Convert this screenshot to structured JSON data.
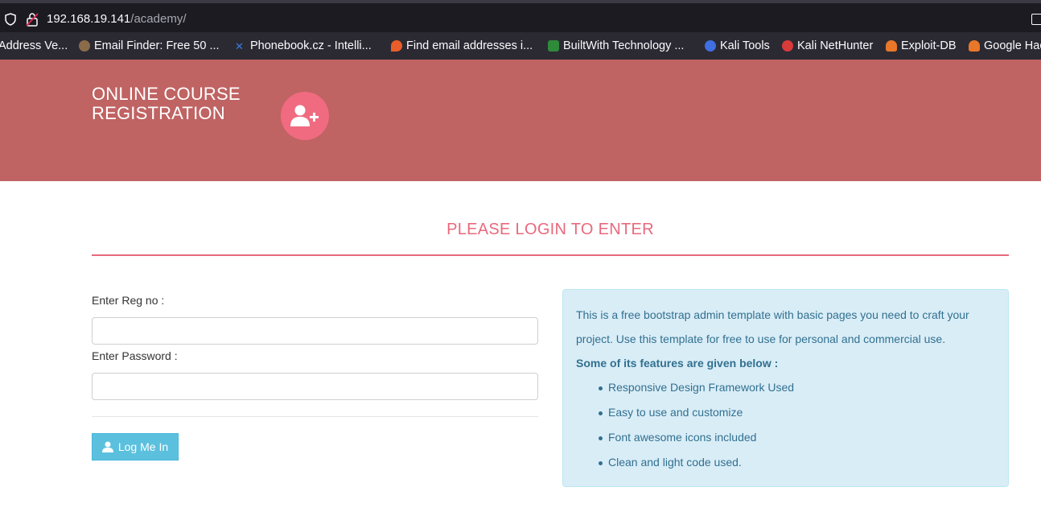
{
  "browser": {
    "url_host": "192.168.19.141",
    "url_path": "/academy/",
    "bookmarks": [
      {
        "label": "Address Ve...",
        "color": "#f5a623"
      },
      {
        "label": "Email Finder: Free 50 ...",
        "color": "#8a6b4a"
      },
      {
        "label": "Phonebook.cz - Intelli...",
        "color": "#3b7be0"
      },
      {
        "label": "Find email addresses i...",
        "color": "#e85d2a"
      },
      {
        "label": "BuiltWith Technology ...",
        "color": "#2f8a3a"
      },
      {
        "label": "Kali Tools",
        "color": "#3f6fe0"
      },
      {
        "label": "Kali NetHunter",
        "color": "#d93a3a"
      },
      {
        "label": "Exploit-DB",
        "color": "#e8772a"
      },
      {
        "label": "Google Hac",
        "color": "#e8772a"
      }
    ]
  },
  "header": {
    "brand_line1": "ONLINE COURSE",
    "brand_line2": "REGISTRATION",
    "icon": "user-plus-icon",
    "bg_color": "#c06363",
    "icon_bg_color": "#f06b80"
  },
  "main": {
    "title": "PLEASE LOGIN TO ENTER",
    "accent_color": "#e8697d",
    "form": {
      "reg_label": "Enter Reg no :",
      "reg_value": "",
      "password_label": "Enter Password :",
      "password_value": "",
      "login_button": "Log Me In",
      "login_icon": "user-icon"
    },
    "info": {
      "intro": "This is a free bootstrap admin template with basic pages you need to craft your project. Use this template for free to use for personal and commercial use.",
      "features_heading": "Some of its features are given below :",
      "features": [
        "Responsive Design Framework Used",
        "Easy to use and customize",
        "Font awesome icons included",
        "Clean and light code used."
      ]
    }
  }
}
